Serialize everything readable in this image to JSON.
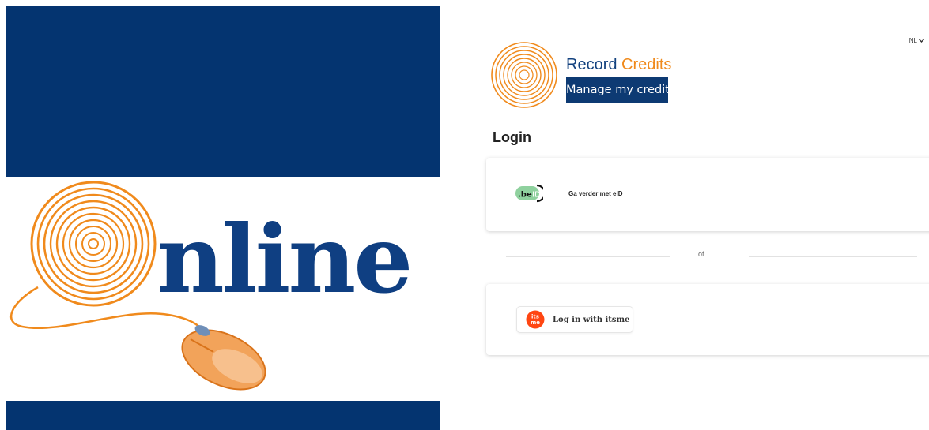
{
  "promo": {
    "word": "nline",
    "colors": {
      "navy": "#043470",
      "word": "#0f3f82",
      "orange": "#f08a1c"
    },
    "icons": [
      "fingerprint-icon",
      "computer-mouse-icon"
    ]
  },
  "header": {
    "language": "NL",
    "language_icon": "chevron-down-icon"
  },
  "brand": {
    "title_part1": "Record",
    "title_part2": "Credits",
    "tagline": "Manage my credit",
    "logo_icon": "fingerprint-icon",
    "colors": {
      "blue": "#13427f",
      "orange": "#f08a1c",
      "tagline_bg": "#0d3a73"
    }
  },
  "login": {
    "heading": "Login",
    "eid": {
      "badge_text": "beID",
      "label": "Ga verder met eID",
      "badge_color": "#8fd19e"
    },
    "separator": "of",
    "itsme": {
      "logo_text": "its me",
      "label": "Log in with itsme",
      "logo_color": "#ff4612"
    }
  }
}
